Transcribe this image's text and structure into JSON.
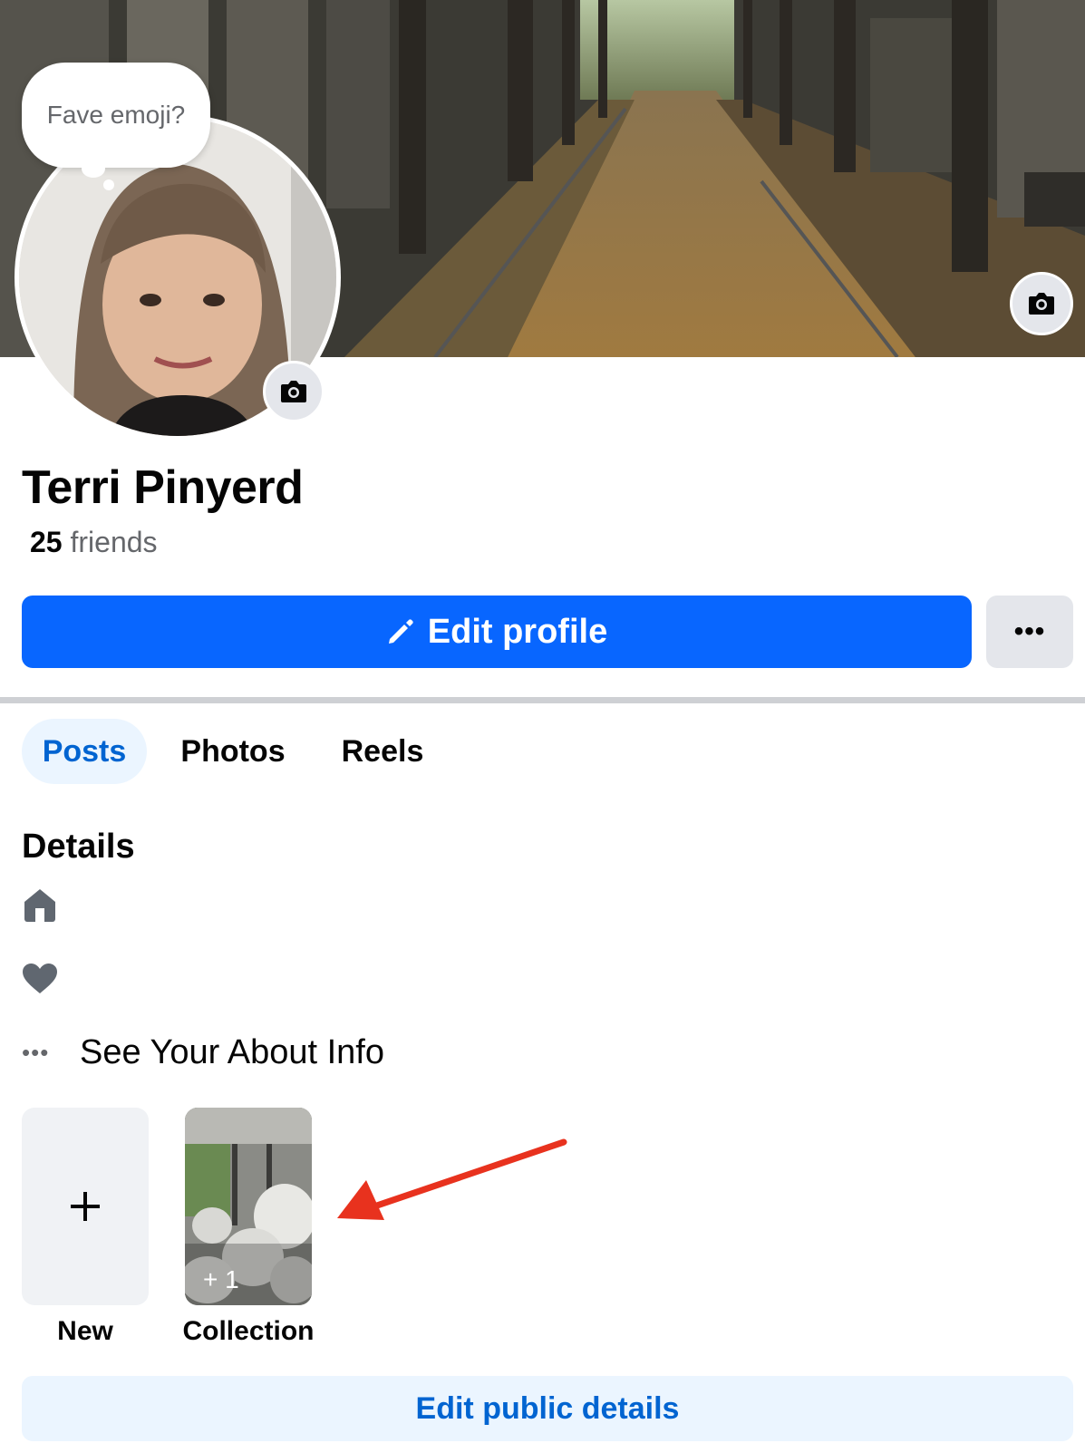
{
  "cover": {
    "camera_icon": "camera-icon"
  },
  "profile": {
    "thought_bubble": "Fave emoji?",
    "name": "Terri Pinyerd",
    "friends_count": "25",
    "friends_label": " friends",
    "camera_icon": "camera-icon"
  },
  "actions": {
    "edit_profile_label": "Edit profile",
    "edit_icon": "pencil-icon",
    "more_label": "•••"
  },
  "tabs": [
    {
      "label": "Posts",
      "active": true
    },
    {
      "label": "Photos",
      "active": false
    },
    {
      "label": "Reels",
      "active": false
    }
  ],
  "details": {
    "heading": "Details",
    "items": [
      {
        "icon": "home-icon"
      },
      {
        "icon": "heart-icon"
      }
    ],
    "about_dots": "•••",
    "about_label": "See Your About Info"
  },
  "featured": {
    "new_label": "New",
    "new_icon": "plus-icon",
    "collection_label": "Collection",
    "collection_count": "+ 1"
  },
  "colors": {
    "primary": "#0866ff",
    "secondary_bg": "#ebf5ff",
    "secondary_text": "#0064d1",
    "annotation_arrow": "#e8321e"
  },
  "footer": {
    "edit_public_details_label": "Edit public details"
  }
}
